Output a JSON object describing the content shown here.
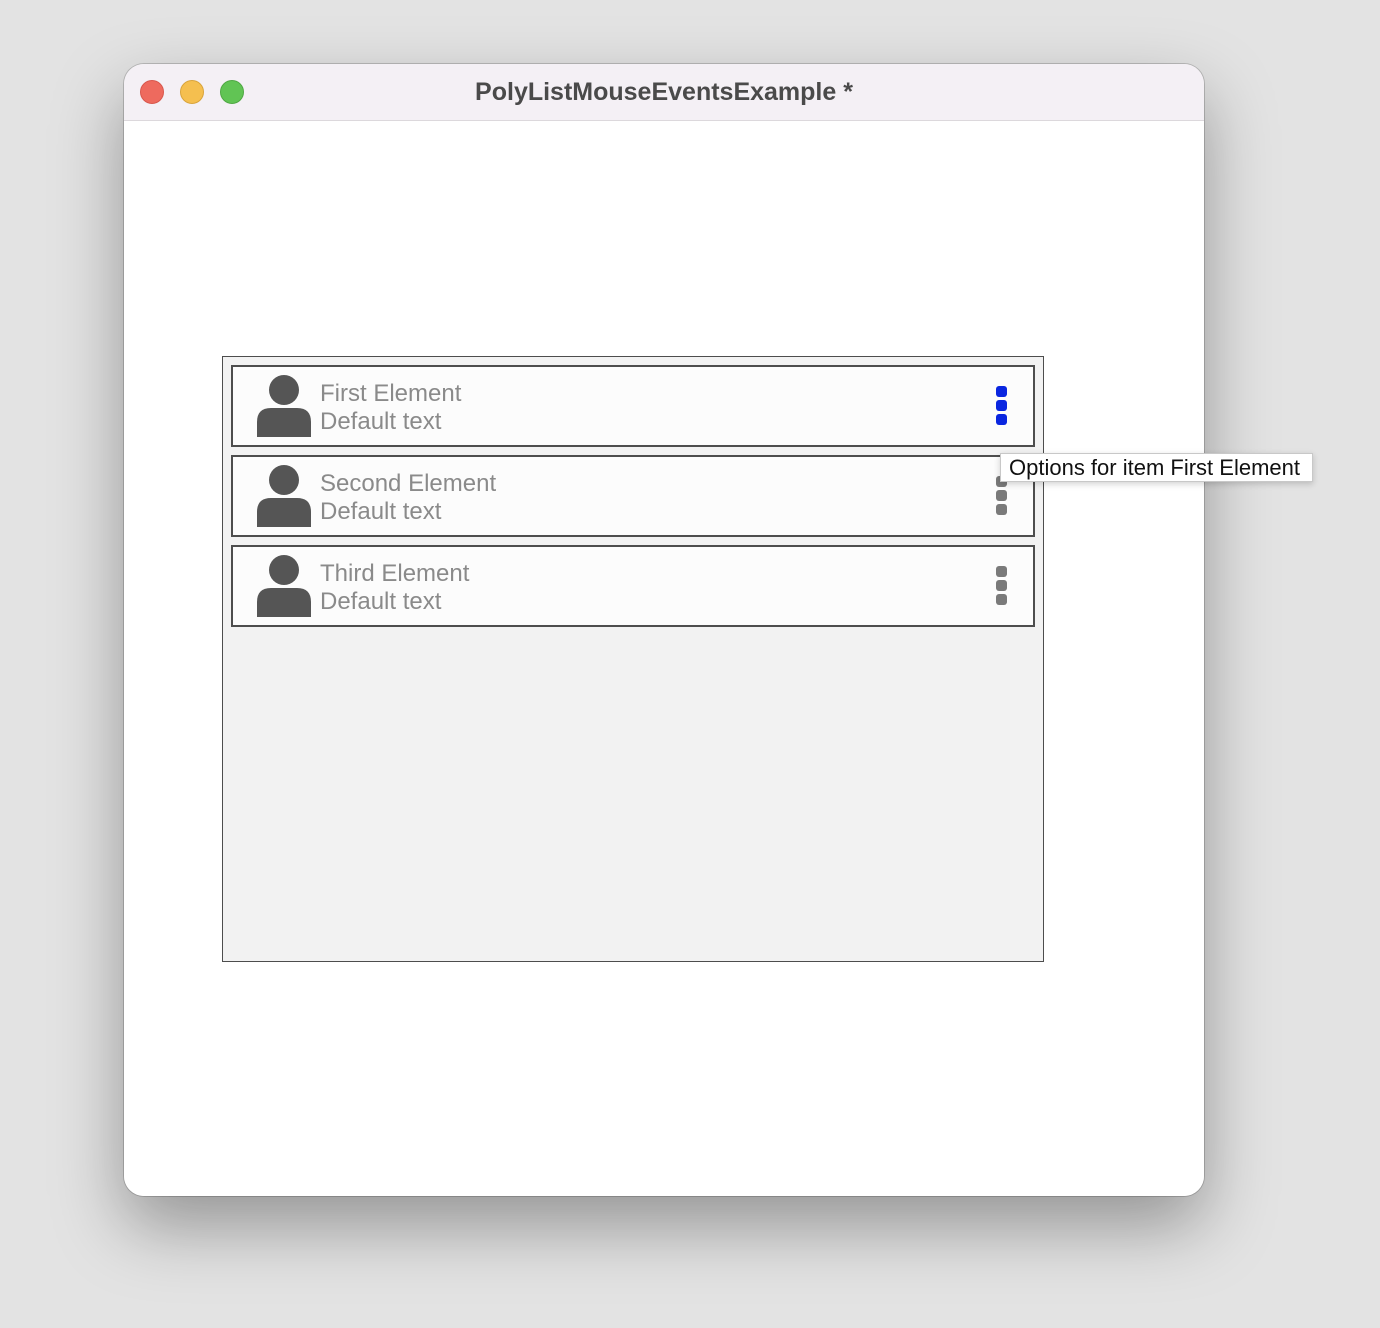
{
  "window": {
    "title": "PolyListMouseEventsExample *"
  },
  "list": {
    "items": [
      {
        "title": "First Element",
        "subtitle": "Default text",
        "options_state": "hovered"
      },
      {
        "title": "Second Element",
        "subtitle": "Default text",
        "options_state": "normal"
      },
      {
        "title": "Third Element",
        "subtitle": "Default text",
        "options_state": "normal"
      }
    ]
  },
  "tooltip": {
    "text": "Options for item First Element"
  },
  "colors": {
    "options_hover": "#0a26e0",
    "options_normal": "#7a7a7a",
    "avatar": "#555555"
  },
  "icons": {
    "avatar": "person-icon",
    "options": "vertical-dots-icon"
  }
}
